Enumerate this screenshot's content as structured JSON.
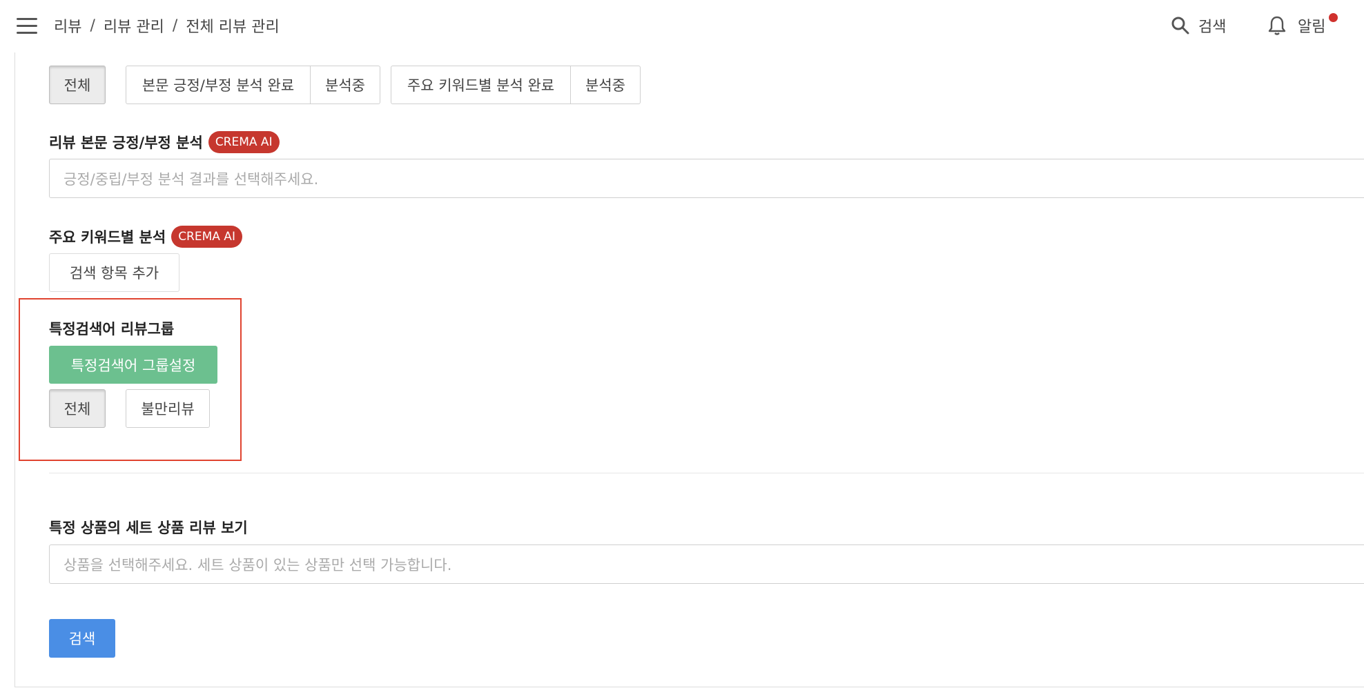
{
  "header": {
    "breadcrumb": [
      "리뷰",
      "리뷰 관리",
      "전체 리뷰 관리"
    ],
    "breadcrumb_sep": "/",
    "search_label": "검색",
    "alarm_label": "알림"
  },
  "analysis_filter": {
    "all": "전체",
    "body_done": "본문 긍정/부정 분석 완료",
    "body_progress": "분석중",
    "keyword_done": "주요 키워드별 분석 완료",
    "keyword_progress": "분석중"
  },
  "sentiment": {
    "title": "리뷰 본문 긍정/부정 분석",
    "badge": "CREMA AI",
    "placeholder": "긍정/중립/부정 분석 결과를 선택해주세요."
  },
  "keyword": {
    "title": "주요 키워드별 분석",
    "badge": "CREMA AI",
    "add_button": "검색 항목 추가"
  },
  "term_group": {
    "title": "특정검색어 리뷰그룹",
    "setup_button": "특정검색어 그룹설정",
    "options": [
      "전체",
      "불만리뷰"
    ]
  },
  "set_product": {
    "title": "특정 상품의 세트 상품 리뷰 보기",
    "placeholder": "상품을 선택해주세요. 세트 상품이 있는 상품만 선택 가능합니다."
  },
  "actions": {
    "search_button": "검색"
  },
  "colors": {
    "badge": "#c6372e",
    "green_button": "#6cc08f",
    "blue_button": "#4a8ee5",
    "highlight": "#e0432f",
    "alarm_dot": "#d0312d"
  }
}
